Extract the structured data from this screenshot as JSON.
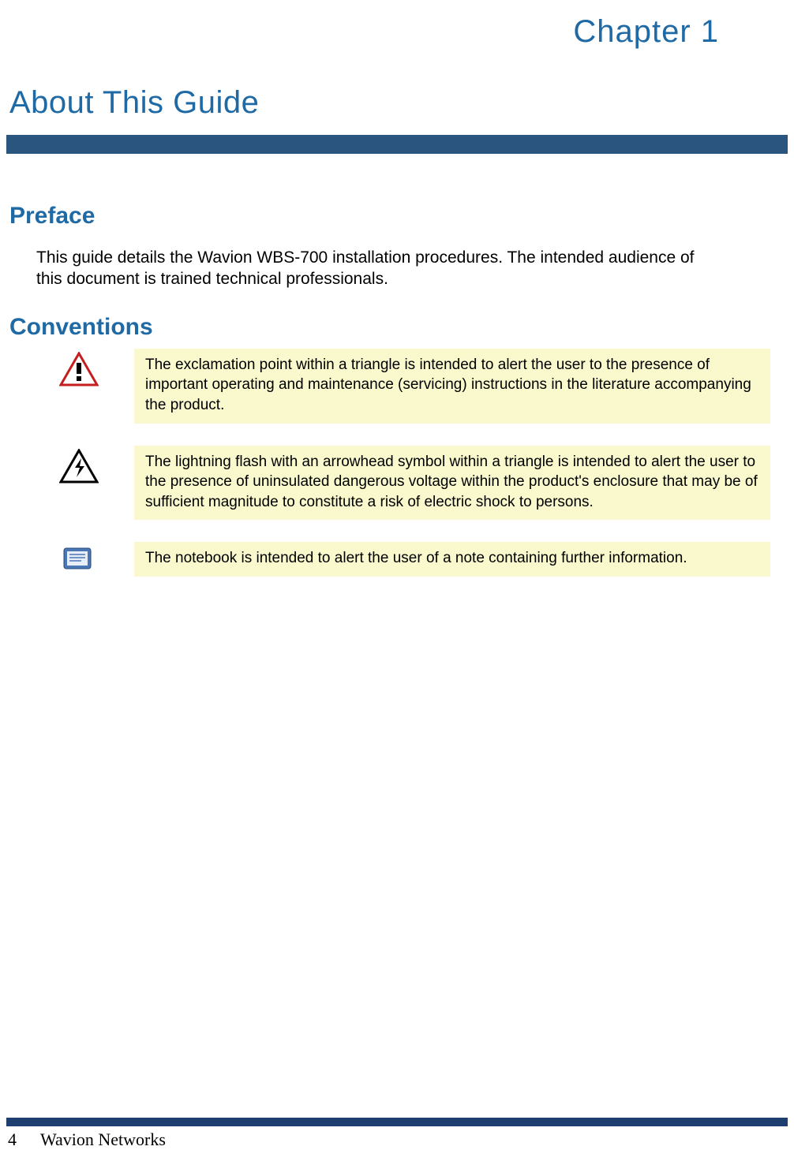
{
  "chapter_label": "Chapter 1",
  "main_title": "About This Guide",
  "sections": {
    "preface": {
      "heading": "Preface",
      "body": "This guide details the Wavion WBS-700 installation procedures. The intended audience of this document is trained technical professionals."
    },
    "conventions": {
      "heading": "Conventions",
      "items": [
        {
          "icon": "warning-triangle-icon",
          "text": "The exclamation point within a triangle is intended to alert the user to the presence of important operating and maintenance (servicing) instructions in the literature accompanying the product."
        },
        {
          "icon": "electric-shock-icon",
          "text": "The lightning flash with an arrowhead symbol within a triangle is intended to alert the user to the presence of uninsulated dangerous voltage within the product's enclosure that may be of sufficient magnitude to constitute a risk of electric shock to persons."
        },
        {
          "icon": "notebook-icon",
          "text": "The notebook is intended to alert the user of a note containing further information."
        }
      ]
    }
  },
  "footer": {
    "page_number": "4",
    "company": "Wavion Networks"
  }
}
